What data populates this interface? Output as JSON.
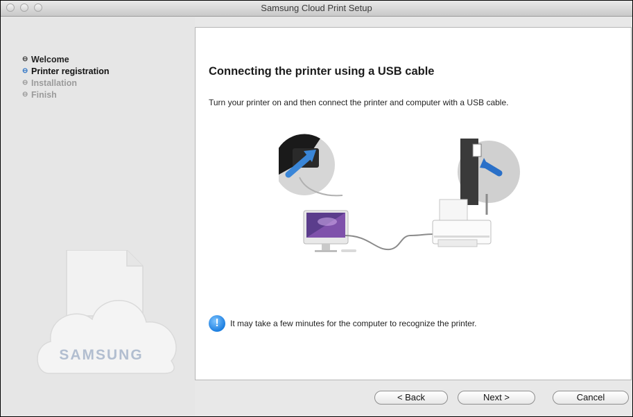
{
  "window": {
    "title": "Samsung Cloud Print Setup"
  },
  "sidebar": {
    "steps": [
      {
        "label": "Welcome",
        "state": "done"
      },
      {
        "label": "Printer registration",
        "state": "active"
      },
      {
        "label": "Installation",
        "state": "pending"
      },
      {
        "label": "Finish",
        "state": "pending"
      }
    ],
    "logo_text": "SAMSUNG"
  },
  "content": {
    "heading": "Connecting the printer using a USB cable",
    "description": "Turn your printer on and then connect the printer and computer with a USB cable.",
    "notice_icon": "!",
    "notice": "It may take a few minutes for the computer to recognize the printer."
  },
  "buttons": {
    "back": "< Back",
    "next": "Next >",
    "cancel": "Cancel"
  },
  "colors": {
    "accent": "#1d7fe0",
    "active_bullet": "#3478c6",
    "pending_text": "#9b9b9b"
  },
  "icons": {
    "step_bullet": "circled-dash",
    "notice": "info-icon",
    "illustration": "usb-connection-illustration"
  }
}
